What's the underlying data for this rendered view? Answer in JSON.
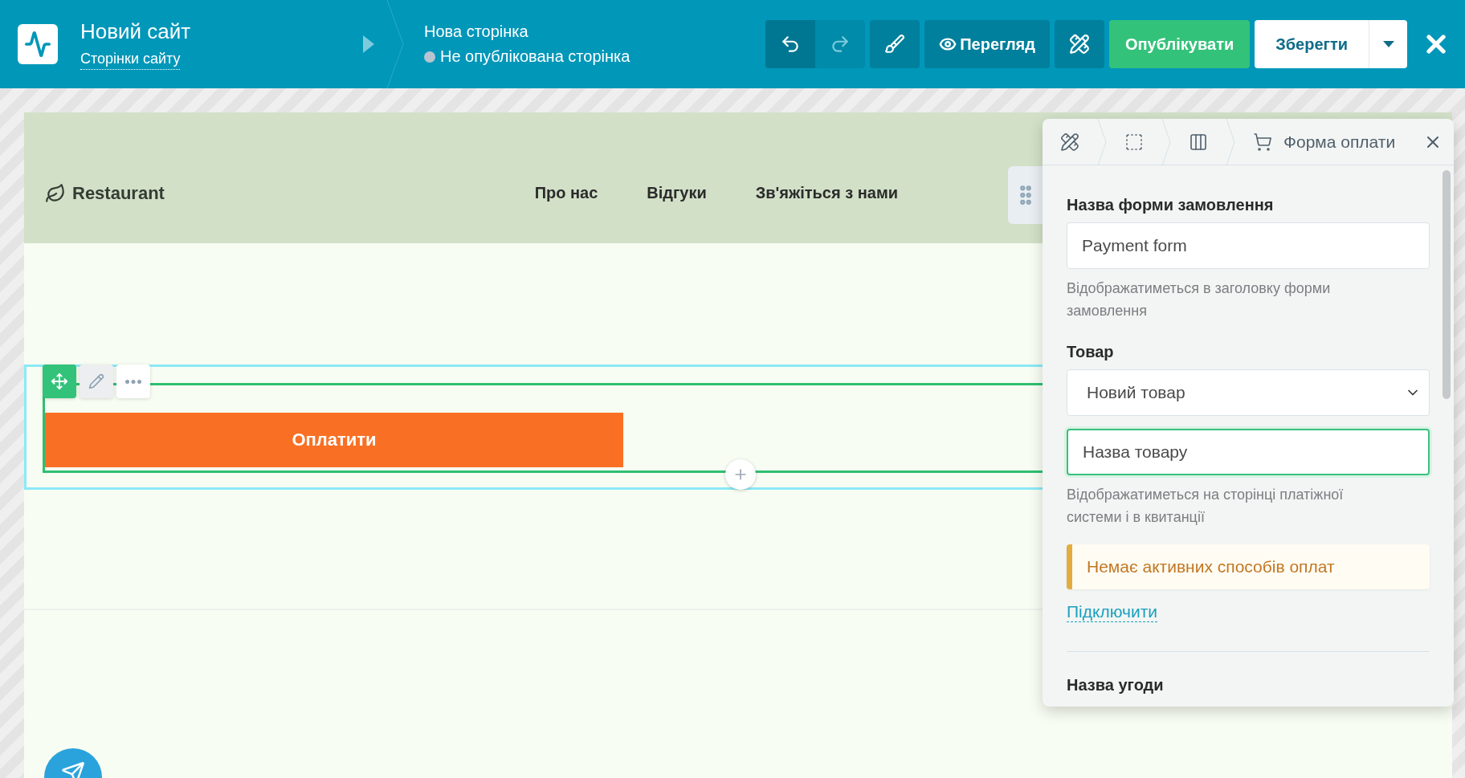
{
  "header": {
    "site_title": "Новий сайт",
    "site_pages_link": "Сторінки сайту",
    "page_title": "Нова сторінка",
    "page_status": {
      "text": "Не опублікована сторінка",
      "published": false
    }
  },
  "toolbar": [
    {
      "kind": "undo",
      "disabled": false
    },
    {
      "kind": "redo",
      "disabled": true
    },
    {
      "kind": "style",
      "disabled": false
    },
    {
      "kind": "preview",
      "label": "Перегляд",
      "disabled": false
    },
    {
      "kind": "design",
      "disabled": false
    },
    {
      "kind": "publish",
      "label": "Опублікувати",
      "disabled": false
    },
    {
      "kind": "save",
      "label": "Зберегти",
      "disabled": false
    }
  ],
  "site": {
    "logo": "Restaurant",
    "nav": [
      "Про нас",
      "Відгуки",
      "Зв'яжіться з нами"
    ],
    "pay_button": "Оплатити"
  },
  "panel": {
    "breadcrumbs": [
      {
        "kind": "design"
      },
      {
        "kind": "section"
      },
      {
        "kind": "block"
      },
      {
        "kind": "cart",
        "label": "Форма оплати"
      }
    ],
    "items": [
      {
        "kind": "label",
        "text": "Назва форми замовлення"
      },
      {
        "kind": "input",
        "value": "Payment form",
        "focused": false
      },
      {
        "kind": "hint",
        "text": "Відображатиметься в заголовку форми замовлення"
      },
      {
        "kind": "label",
        "text": "Товар"
      },
      {
        "kind": "select",
        "value": "Новий товар"
      },
      {
        "kind": "input",
        "value": "Назва товару",
        "focused": true
      },
      {
        "kind": "hint",
        "text": "Відображатиметься на сторінці платіжної системи і в квитанції"
      },
      {
        "kind": "warning",
        "text": "Немає активних способів оплат"
      },
      {
        "kind": "link",
        "text": "Підключити"
      },
      {
        "kind": "divider"
      },
      {
        "kind": "label",
        "text": "Назва угоди"
      }
    ]
  }
}
